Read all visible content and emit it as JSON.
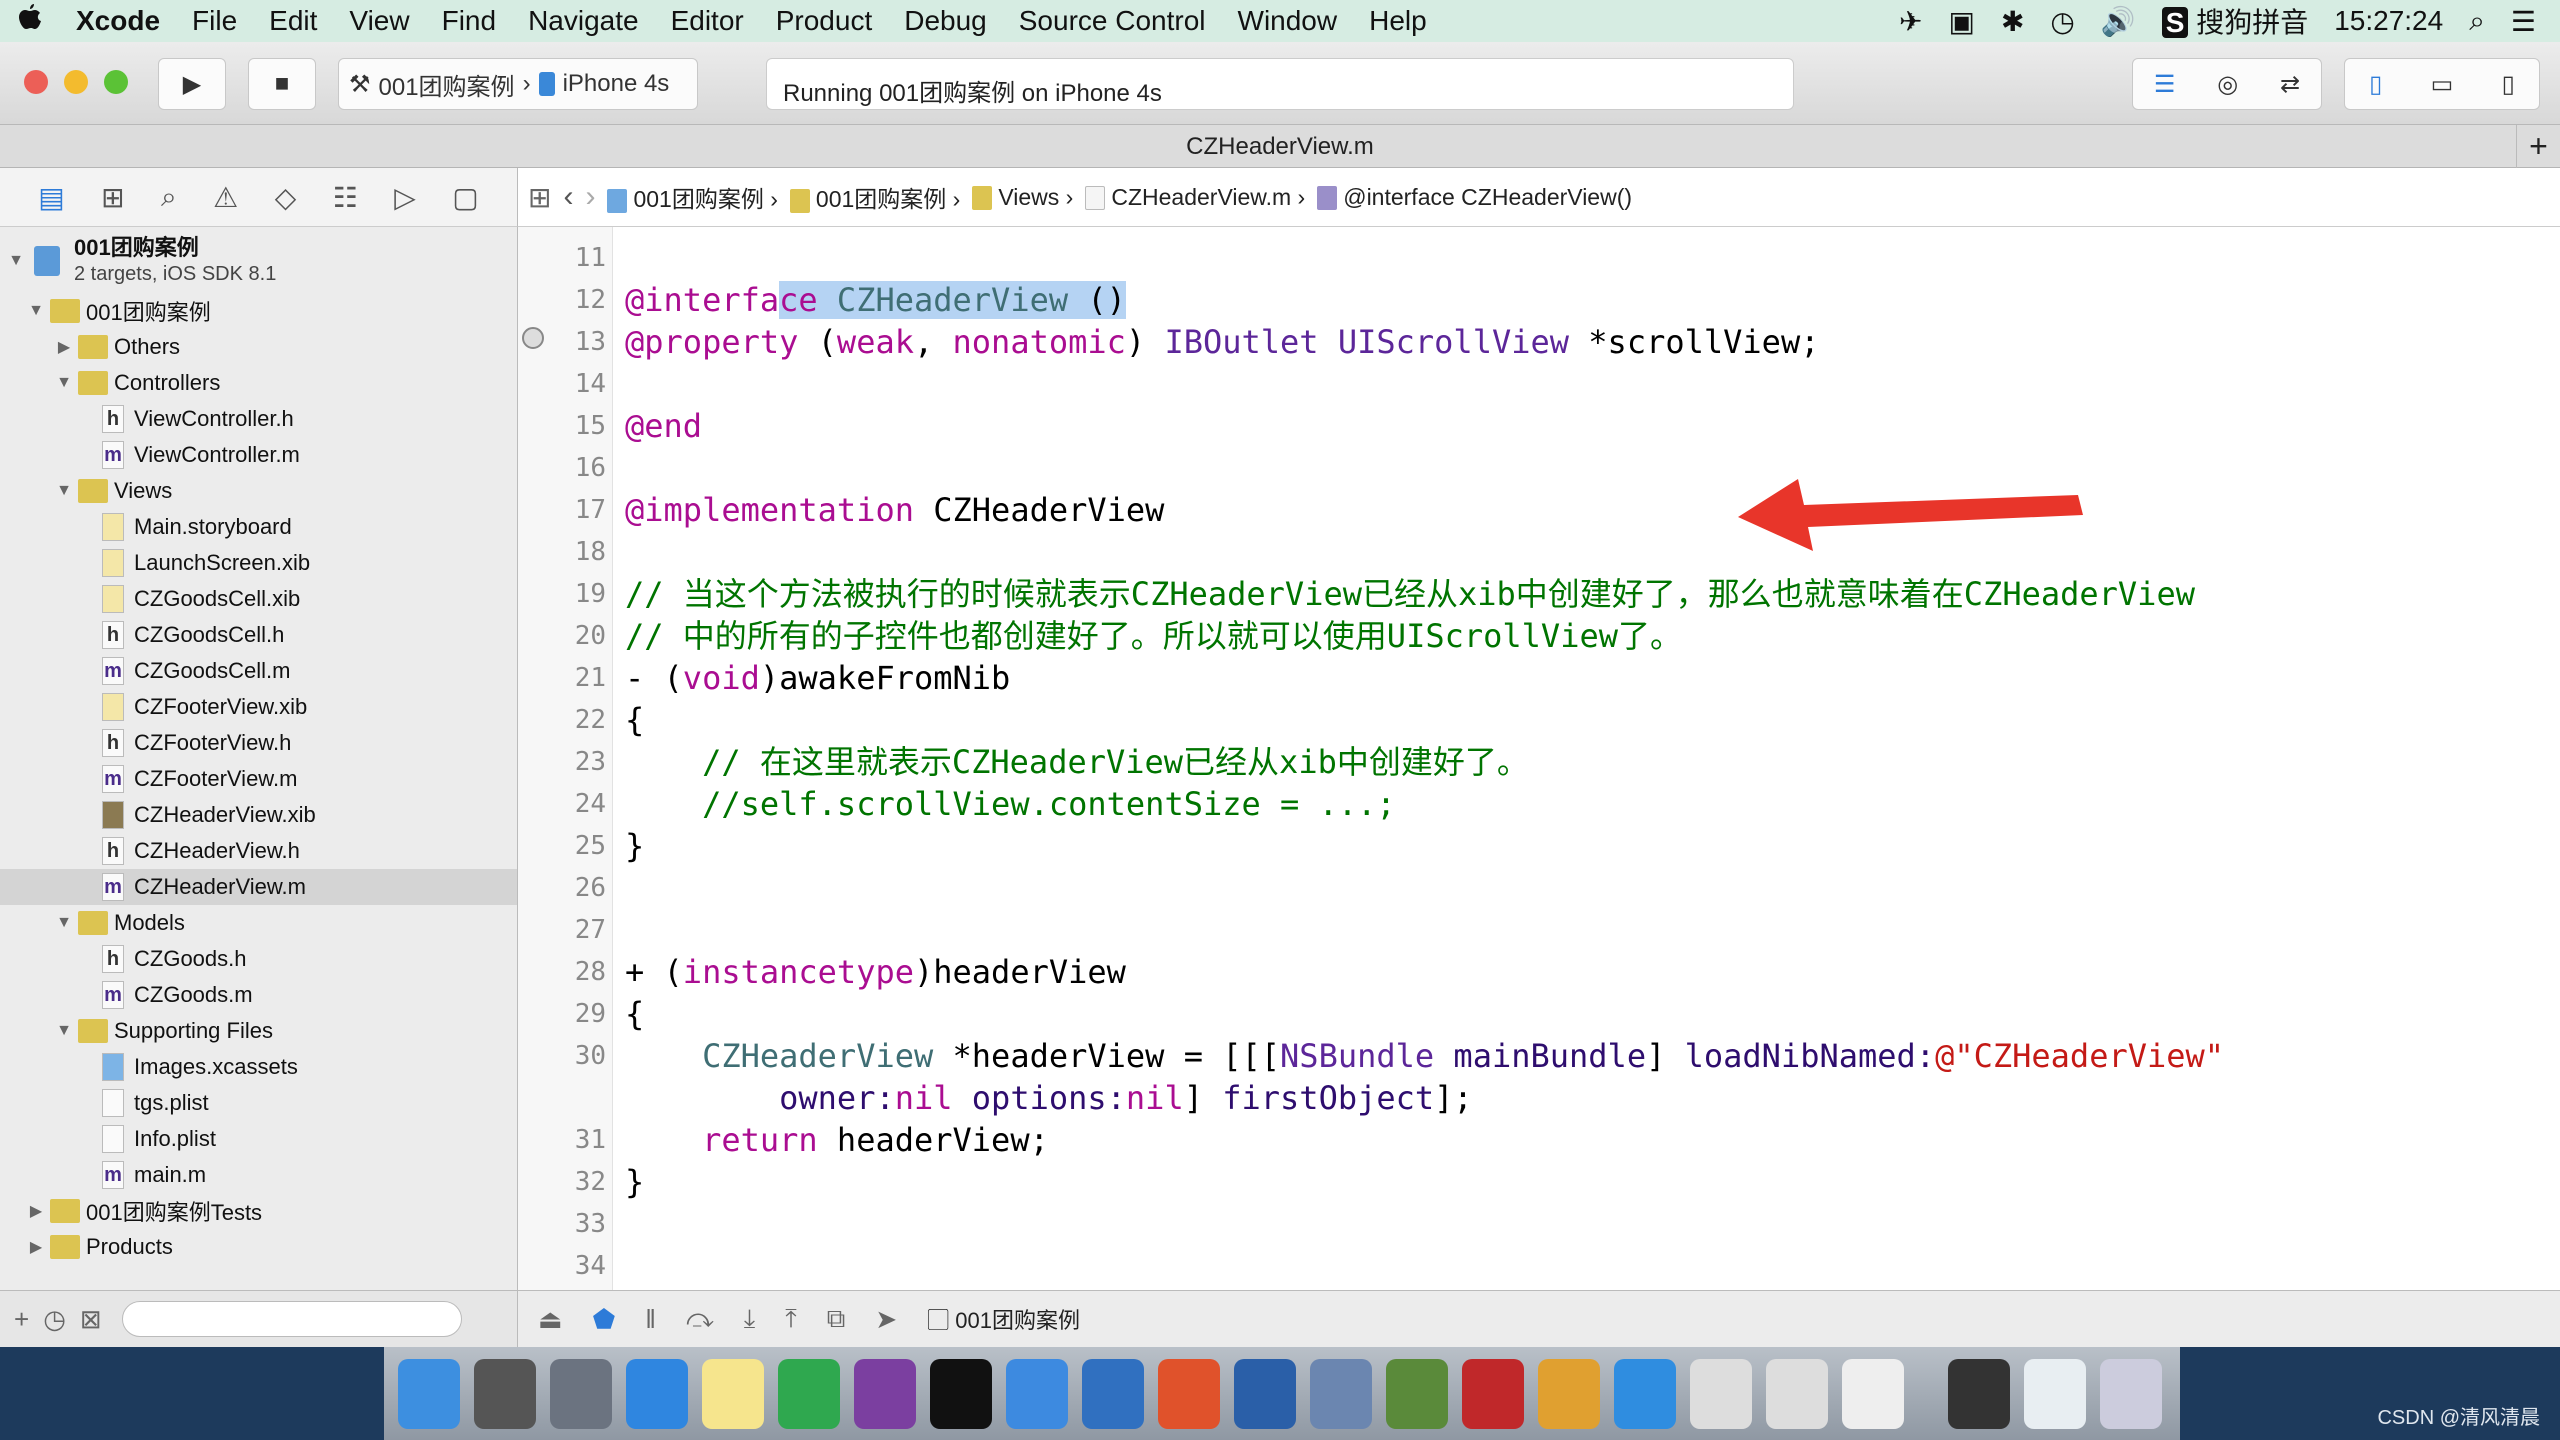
{
  "menubar": {
    "items": [
      "Xcode",
      "File",
      "Edit",
      "View",
      "Find",
      "Navigate",
      "Editor",
      "Product",
      "Debug",
      "Source Control",
      "Window",
      "Help"
    ],
    "input_method": "搜狗拼音",
    "clock": "15:27:24"
  },
  "toolbar": {
    "scheme": "001团购案例",
    "device": "iPhone 4s",
    "activity": "Running 001团购案例 on iPhone 4s"
  },
  "tab": {
    "title": "CZHeaderView.m"
  },
  "jumpbar": {
    "items": [
      "001团购案例",
      "001团购案例",
      "Views",
      "CZHeaderView.m",
      "@interface CZHeaderView()"
    ]
  },
  "sidebar": {
    "project": {
      "name": "001团购案例",
      "subtitle": "2 targets, iOS SDK 8.1"
    },
    "items": [
      {
        "label": "001团购案例",
        "level": 1,
        "kind": "folder",
        "open": true
      },
      {
        "label": "Others",
        "level": 2,
        "kind": "folder",
        "open": false
      },
      {
        "label": "Controllers",
        "level": 2,
        "kind": "folder",
        "open": true
      },
      {
        "label": "ViewController.h",
        "level": 3,
        "kind": "h"
      },
      {
        "label": "ViewController.m",
        "level": 3,
        "kind": "m"
      },
      {
        "label": "Views",
        "level": 2,
        "kind": "folder",
        "open": true
      },
      {
        "label": "Main.storyboard",
        "level": 3,
        "kind": "x"
      },
      {
        "label": "LaunchScreen.xib",
        "level": 3,
        "kind": "x"
      },
      {
        "label": "CZGoodsCell.xib",
        "level": 3,
        "kind": "x"
      },
      {
        "label": "CZGoodsCell.h",
        "level": 3,
        "kind": "h"
      },
      {
        "label": "CZGoodsCell.m",
        "level": 3,
        "kind": "m"
      },
      {
        "label": "CZFooterView.xib",
        "level": 3,
        "kind": "x"
      },
      {
        "label": "CZFooterView.h",
        "level": 3,
        "kind": "h"
      },
      {
        "label": "CZFooterView.m",
        "level": 3,
        "kind": "m"
      },
      {
        "label": "CZHeaderView.xib",
        "level": 3,
        "kind": "xd"
      },
      {
        "label": "CZHeaderView.h",
        "level": 3,
        "kind": "h"
      },
      {
        "label": "CZHeaderView.m",
        "level": 3,
        "kind": "m",
        "selected": true
      },
      {
        "label": "Models",
        "level": 2,
        "kind": "folder",
        "open": true
      },
      {
        "label": "CZGoods.h",
        "level": 3,
        "kind": "h"
      },
      {
        "label": "CZGoods.m",
        "level": 3,
        "kind": "m"
      },
      {
        "label": "Supporting Files",
        "level": 2,
        "kind": "folder",
        "open": true
      },
      {
        "label": "Images.xcassets",
        "level": 3,
        "kind": "a"
      },
      {
        "label": "tgs.plist",
        "level": 3,
        "kind": "p"
      },
      {
        "label": "Info.plist",
        "level": 3,
        "kind": "p"
      },
      {
        "label": "main.m",
        "level": 3,
        "kind": "m"
      },
      {
        "label": "001团购案例Tests",
        "level": 1,
        "kind": "folder",
        "open": false
      },
      {
        "label": "Products",
        "level": 1,
        "kind": "folder",
        "open": false
      }
    ]
  },
  "code": {
    "lines": [
      {
        "n": "11",
        "t": []
      },
      {
        "n": "12",
        "t": [
          [
            "kw",
            "@interfa"
          ],
          [
            "kw hl",
            "ce"
          ],
          [
            "cls hl",
            " CZHeaderView "
          ],
          [
            "pl hl",
            "()"
          ]
        ]
      },
      {
        "n": "13",
        "t": [
          [
            "kw",
            "@property"
          ],
          [
            "pl",
            " ("
          ],
          [
            "kw",
            "weak"
          ],
          [
            "pl",
            ", "
          ],
          [
            "kw",
            "nonatomic"
          ],
          [
            "pl",
            ") "
          ],
          [
            "ty",
            "IBOutlet"
          ],
          [
            "pl",
            " "
          ],
          [
            "ty",
            "UIScrollView"
          ],
          [
            "pl",
            " *scrollView;"
          ]
        ]
      },
      {
        "n": "14",
        "t": []
      },
      {
        "n": "15",
        "t": [
          [
            "kw",
            "@end"
          ]
        ]
      },
      {
        "n": "16",
        "t": []
      },
      {
        "n": "17",
        "t": [
          [
            "kw",
            "@implementation"
          ],
          [
            "pl",
            " CZHeaderView"
          ]
        ]
      },
      {
        "n": "18",
        "t": []
      },
      {
        "n": "19",
        "t": [
          [
            "cm",
            "// 当这个方法被执行的时候就表示CZHeaderView已经从xib中创建好了，那么也就意味着在CZHeaderView"
          ]
        ]
      },
      {
        "n": "20",
        "t": [
          [
            "cm",
            "// 中的所有的子控件也都创建好了。所以就可以使用UIScrollView了。"
          ]
        ]
      },
      {
        "n": "21",
        "t": [
          [
            "pl",
            "- ("
          ],
          [
            "kw",
            "void"
          ],
          [
            "pl",
            ")awakeFromNib"
          ]
        ]
      },
      {
        "n": "22",
        "t": [
          [
            "pl",
            "{"
          ]
        ]
      },
      {
        "n": "23",
        "t": [
          [
            "cm",
            "    // 在这里就表示CZHeaderView已经从xib中创建好了。"
          ]
        ]
      },
      {
        "n": "24",
        "t": [
          [
            "cm",
            "    //self.scrollView.contentSize = ...;"
          ]
        ]
      },
      {
        "n": "25",
        "t": [
          [
            "pl",
            "}"
          ]
        ]
      },
      {
        "n": "26",
        "t": []
      },
      {
        "n": "27",
        "t": []
      },
      {
        "n": "28",
        "t": [
          [
            "pl",
            "+ ("
          ],
          [
            "kw",
            "instancetype"
          ],
          [
            "pl",
            ")headerView"
          ]
        ]
      },
      {
        "n": "29",
        "t": [
          [
            "pl",
            "{"
          ]
        ]
      },
      {
        "n": "30",
        "t": [
          [
            "cls",
            "    CZHeaderView"
          ],
          [
            "pl",
            " *headerView = [[["
          ],
          [
            "ty",
            "NSBundle"
          ],
          [
            "me",
            " mainBundle"
          ],
          [
            "pl",
            "] "
          ],
          [
            "me",
            "loadNibNamed:"
          ],
          [
            "st",
            "@\"CZHeaderView\""
          ]
        ]
      },
      {
        "n": "",
        "t": [
          [
            "me",
            "        owner:"
          ],
          [
            "kw",
            "nil"
          ],
          [
            "me",
            " options:"
          ],
          [
            "kw",
            "nil"
          ],
          [
            "pl",
            "] "
          ],
          [
            "me",
            "firstObject"
          ],
          [
            "pl",
            "];"
          ]
        ]
      },
      {
        "n": "31",
        "t": [
          [
            "kw",
            "    return"
          ],
          [
            "pl",
            " headerView;"
          ]
        ]
      },
      {
        "n": "32",
        "t": [
          [
            "pl",
            "}"
          ]
        ]
      },
      {
        "n": "33",
        "t": []
      },
      {
        "n": "34",
        "t": []
      }
    ]
  },
  "debugbar": {
    "target": "001团购案例"
  },
  "watermark": "CSDN @清风清晨",
  "colors": {
    "keyword": "#aa0d91",
    "comment": "#007400",
    "string": "#c41a16",
    "type": "#5c2699",
    "selection": "#b5d3f3",
    "arrow": "#e8352a"
  }
}
